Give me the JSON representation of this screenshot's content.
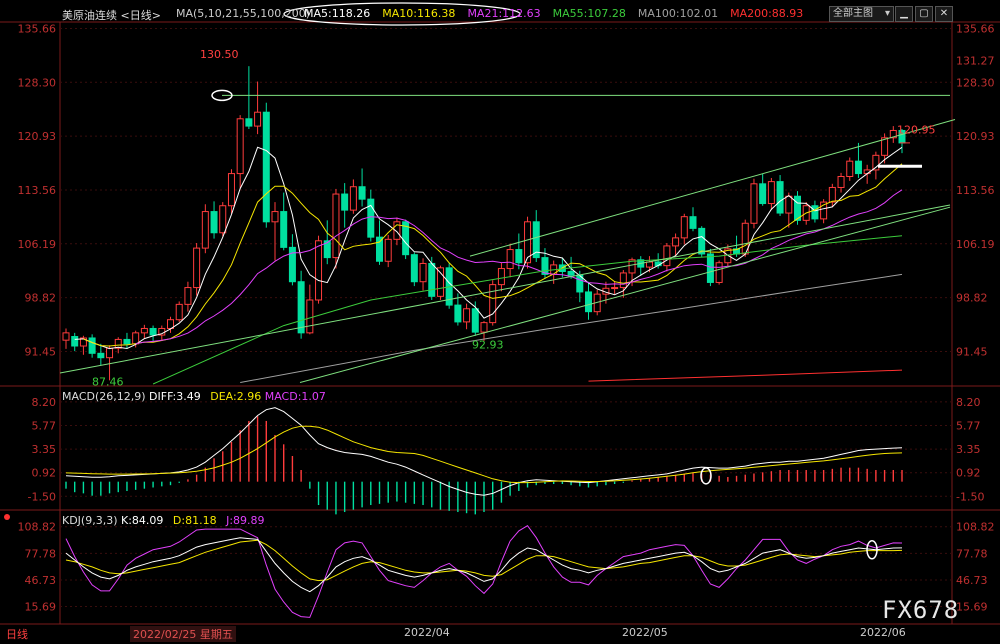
{
  "header": {
    "title": "美原油连续",
    "period": "<日线>",
    "ma_params": "MA(5,10,21,55,100,200)",
    "ma_values": [
      {
        "label": "MA5:118.26",
        "color": "#ffffff"
      },
      {
        "label": "MA10:116.38",
        "color": "#f5e600"
      },
      {
        "label": "MA21:112.63",
        "color": "#e040fb"
      },
      {
        "label": "MA55:107.28",
        "color": "#3ccc3c"
      },
      {
        "label": "MA100:102.01",
        "color": "#a0a0a0"
      },
      {
        "label": "MA200:88.93",
        "color": "#ff3030"
      }
    ],
    "dropdown_label": "全部主图",
    "dropdown_icon": "chevron-down-icon"
  },
  "window_buttons": {
    "minimize_icon": "minimize-icon",
    "restore_icon": "restore-icon",
    "close_icon": "close-icon"
  },
  "price_axis": {
    "ticks": [
      "135.66",
      "128.30",
      "120.93",
      "113.56",
      "106.19",
      "98.82",
      "91.45"
    ],
    "right_extra": "131.27"
  },
  "annotations": {
    "high": "130.50",
    "low1": "87.46",
    "low2": "92.93",
    "last": "120.95"
  },
  "macd": {
    "title": "MACD(26,12,9)",
    "diff": "DIFF:3.49",
    "dea": "DEA:2.96",
    "macd": "MACD:1.07",
    "ticks": [
      "8.20",
      "5.77",
      "3.35",
      "0.92",
      "-1.50"
    ]
  },
  "kdj": {
    "title": "KDJ(9,3,3)",
    "k": "K:84.09",
    "d": "D:81.18",
    "j": "J:89.89",
    "ticks": [
      "108.82",
      "77.78",
      "46.73",
      "15.69"
    ]
  },
  "footer": {
    "period_tab": "日线",
    "cursor_date": "2022/02/25 星期五",
    "dates": [
      "2022/04",
      "2022/05",
      "2022/06"
    ]
  },
  "watermark": "FX678",
  "chart_data": {
    "type": "candlestick",
    "price_range": [
      87.0,
      136.0
    ],
    "candles": [
      [
        93.0,
        94.6,
        91.8,
        94.0
      ],
      [
        93.5,
        94.0,
        91.5,
        92.2
      ],
      [
        92.2,
        93.6,
        91.0,
        93.3
      ],
      [
        93.3,
        93.8,
        90.6,
        91.2
      ],
      [
        91.2,
        92.5,
        89.6,
        90.6
      ],
      [
        90.6,
        92.3,
        87.5,
        91.9
      ],
      [
        91.9,
        93.4,
        91.2,
        93.1
      ],
      [
        93.1,
        94.0,
        91.9,
        92.5
      ],
      [
        92.5,
        94.3,
        92.0,
        94.0
      ],
      [
        94.0,
        95.1,
        93.3,
        94.6
      ],
      [
        94.6,
        95.0,
        92.8,
        93.7
      ],
      [
        93.7,
        95.0,
        93.0,
        94.6
      ],
      [
        94.6,
        96.2,
        94.0,
        95.8
      ],
      [
        95.8,
        98.3,
        95.5,
        97.9
      ],
      [
        97.9,
        101.0,
        96.9,
        100.2
      ],
      [
        100.2,
        106.3,
        99.1,
        105.6
      ],
      [
        105.6,
        111.6,
        104.9,
        110.6
      ],
      [
        110.6,
        112.0,
        106.9,
        107.7
      ],
      [
        107.7,
        111.9,
        107.2,
        111.4
      ],
      [
        111.4,
        116.4,
        110.3,
        115.8
      ],
      [
        115.8,
        123.8,
        113.8,
        123.3
      ],
      [
        123.3,
        130.5,
        121.9,
        122.3
      ],
      [
        122.3,
        128.4,
        121.2,
        124.2
      ],
      [
        124.2,
        125.5,
        108.4,
        109.2
      ],
      [
        109.2,
        111.9,
        103.9,
        110.6
      ],
      [
        110.6,
        113.2,
        105.3,
        105.7
      ],
      [
        105.7,
        107.5,
        100.5,
        101.0
      ],
      [
        101.0,
        102.5,
        93.2,
        94.0
      ],
      [
        94.0,
        100.6,
        93.8,
        98.5
      ],
      [
        98.5,
        107.3,
        98.0,
        106.6
      ],
      [
        106.6,
        109.4,
        103.4,
        104.3
      ],
      [
        104.3,
        113.7,
        102.8,
        113.0
      ],
      [
        113.0,
        114.5,
        108.4,
        110.8
      ],
      [
        110.8,
        115.0,
        110.3,
        114.0
      ],
      [
        114.0,
        116.5,
        111.3,
        112.3
      ],
      [
        112.3,
        113.6,
        106.5,
        107.1
      ],
      [
        107.1,
        109.4,
        103.3,
        103.8
      ],
      [
        103.8,
        107.4,
        103.0,
        106.8
      ],
      [
        106.8,
        109.8,
        106.0,
        109.2
      ],
      [
        109.2,
        109.5,
        104.1,
        104.7
      ],
      [
        104.7,
        105.0,
        100.4,
        101.0
      ],
      [
        101.0,
        104.2,
        99.8,
        103.5
      ],
      [
        103.5,
        104.4,
        98.5,
        99.0
      ],
      [
        99.0,
        103.2,
        98.5,
        102.9
      ],
      [
        102.9,
        103.5,
        97.3,
        97.8
      ],
      [
        97.8,
        99.4,
        95.0,
        95.5
      ],
      [
        95.5,
        98.0,
        94.5,
        97.3
      ],
      [
        97.3,
        98.3,
        93.6,
        94.1
      ],
      [
        94.1,
        95.6,
        92.9,
        95.4
      ],
      [
        95.4,
        101.2,
        95.0,
        100.6
      ],
      [
        100.6,
        103.6,
        99.7,
        102.8
      ],
      [
        102.8,
        106.2,
        101.6,
        105.4
      ],
      [
        105.4,
        107.6,
        102.7,
        103.6
      ],
      [
        103.6,
        109.9,
        102.8,
        109.2
      ],
      [
        109.2,
        110.8,
        103.7,
        104.3
      ],
      [
        104.3,
        105.6,
        101.4,
        102.0
      ],
      [
        102.0,
        103.9,
        100.7,
        103.3
      ],
      [
        103.3,
        104.3,
        101.6,
        102.4
      ],
      [
        102.4,
        104.4,
        101.4,
        101.9
      ],
      [
        101.9,
        102.5,
        98.2,
        99.6
      ],
      [
        99.6,
        101.0,
        95.8,
        96.9
      ],
      [
        96.9,
        99.9,
        96.4,
        99.3
      ],
      [
        99.3,
        101.0,
        98.0,
        100.1
      ],
      [
        100.1,
        101.1,
        99.3,
        100.2
      ],
      [
        100.2,
        102.6,
        98.8,
        102.2
      ],
      [
        102.2,
        104.3,
        100.4,
        104.0
      ],
      [
        104.0,
        104.5,
        101.8,
        103.0
      ],
      [
        103.0,
        104.5,
        102.3,
        103.7
      ],
      [
        103.7,
        104.9,
        102.8,
        103.2
      ],
      [
        103.2,
        106.3,
        102.4,
        105.9
      ],
      [
        105.9,
        107.6,
        104.4,
        107.0
      ],
      [
        107.0,
        110.3,
        106.1,
        109.9
      ],
      [
        109.9,
        111.2,
        107.9,
        108.3
      ],
      [
        108.3,
        108.6,
        104.4,
        104.8
      ],
      [
        104.8,
        105.5,
        100.4,
        100.9
      ],
      [
        100.9,
        103.9,
        100.6,
        103.6
      ],
      [
        103.6,
        106.1,
        103.1,
        105.5
      ],
      [
        105.5,
        107.3,
        104.4,
        104.8
      ],
      [
        104.8,
        109.5,
        104.4,
        109.0
      ],
      [
        109.0,
        115.1,
        108.3,
        114.4
      ],
      [
        114.4,
        115.8,
        111.4,
        111.7
      ],
      [
        111.7,
        115.2,
        110.8,
        114.7
      ],
      [
        114.7,
        115.6,
        110.0,
        110.4
      ],
      [
        110.4,
        113.2,
        108.4,
        112.7
      ],
      [
        112.7,
        113.4,
        108.8,
        109.4
      ],
      [
        109.4,
        111.9,
        108.8,
        111.4
      ],
      [
        111.4,
        112.1,
        109.1,
        109.6
      ],
      [
        109.6,
        112.3,
        109.0,
        111.9
      ],
      [
        111.9,
        114.4,
        111.2,
        113.9
      ],
      [
        113.9,
        115.9,
        113.2,
        115.4
      ],
      [
        115.4,
        118.0,
        114.8,
        117.5
      ],
      [
        117.5,
        120.0,
        115.2,
        115.8
      ],
      [
        115.8,
        117.0,
        114.4,
        116.3
      ],
      [
        116.3,
        118.8,
        115.0,
        118.3
      ],
      [
        118.3,
        121.3,
        117.2,
        120.7
      ],
      [
        120.7,
        122.3,
        120.0,
        121.7
      ],
      [
        121.7,
        121.9,
        118.6,
        120.0
      ]
    ],
    "macd_hist": [
      -0.3,
      -0.45,
      -0.5,
      -0.6,
      -0.6,
      -0.5,
      -0.45,
      -0.4,
      -0.35,
      -0.3,
      -0.25,
      -0.2,
      -0.15,
      -0.05,
      0.1,
      0.3,
      0.6,
      1.0,
      1.3,
      1.7,
      2.2,
      2.6,
      2.8,
      2.6,
      2.0,
      1.6,
      1.1,
      0.5,
      -0.3,
      -1.0,
      -1.2,
      -1.4,
      -1.3,
      -1.2,
      -1.1,
      -1.0,
      -0.95,
      -0.9,
      -0.85,
      -0.9,
      -0.95,
      -1.0,
      -1.1,
      -1.2,
      -1.25,
      -1.3,
      -1.35,
      -1.4,
      -1.3,
      -1.2,
      -0.9,
      -0.6,
      -0.4,
      -0.25,
      -0.15,
      -0.1,
      -0.1,
      -0.1,
      -0.15,
      -0.2,
      -0.25,
      -0.2,
      -0.15,
      -0.1,
      -0.05,
      0.05,
      0.1,
      0.15,
      0.2,
      0.25,
      0.3,
      0.35,
      0.4,
      0.35,
      0.3,
      0.25,
      0.2,
      0.25,
      0.3,
      0.35,
      0.4,
      0.45,
      0.5,
      0.5,
      0.5,
      0.5,
      0.5,
      0.5,
      0.55,
      0.6,
      0.6,
      0.6,
      0.55,
      0.5,
      0.5,
      0.5,
      0.5
    ],
    "macd_diff": [
      0.6,
      0.55,
      0.5,
      0.45,
      0.45,
      0.5,
      0.6,
      0.65,
      0.7,
      0.75,
      0.8,
      0.85,
      0.9,
      1.0,
      1.2,
      1.5,
      2.0,
      2.7,
      3.4,
      4.2,
      5.0,
      5.9,
      6.8,
      7.4,
      7.6,
      7.2,
      6.5,
      5.8,
      4.8,
      3.9,
      3.5,
      3.2,
      3.0,
      2.9,
      2.8,
      2.6,
      2.3,
      2.0,
      1.8,
      1.5,
      1.1,
      0.7,
      0.3,
      -0.1,
      -0.5,
      -0.8,
      -1.1,
      -1.3,
      -1.4,
      -1.2,
      -0.8,
      -0.4,
      -0.1,
      0.1,
      0.2,
      0.15,
      0.1,
      0.05,
      0.0,
      -0.05,
      -0.1,
      0.0,
      0.1,
      0.2,
      0.3,
      0.4,
      0.5,
      0.6,
      0.7,
      0.8,
      1.0,
      1.2,
      1.4,
      1.5,
      1.45,
      1.4,
      1.4,
      1.5,
      1.6,
      1.8,
      1.9,
      2.0,
      2.0,
      2.1,
      2.1,
      2.2,
      2.3,
      2.4,
      2.6,
      2.8,
      3.0,
      3.2,
      3.3,
      3.35,
      3.4,
      3.45,
      3.49
    ],
    "macd_dea": [
      0.9,
      0.88,
      0.85,
      0.82,
      0.8,
      0.78,
      0.78,
      0.78,
      0.79,
      0.8,
      0.82,
      0.85,
      0.88,
      0.92,
      0.98,
      1.08,
      1.22,
      1.42,
      1.7,
      2.0,
      2.4,
      2.9,
      3.4,
      4.0,
      4.6,
      5.1,
      5.5,
      5.7,
      5.7,
      5.6,
      5.3,
      4.9,
      4.5,
      4.1,
      3.8,
      3.5,
      3.3,
      3.1,
      3.0,
      2.95,
      2.9,
      2.7,
      2.4,
      2.1,
      1.8,
      1.5,
      1.2,
      0.9,
      0.6,
      0.3,
      0.1,
      -0.05,
      -0.1,
      -0.1,
      -0.05,
      0.0,
      0.05,
      0.08,
      0.07,
      0.05,
      0.02,
      0.02,
      0.04,
      0.08,
      0.14,
      0.2,
      0.28,
      0.36,
      0.45,
      0.55,
      0.66,
      0.78,
      0.92,
      1.04,
      1.13,
      1.2,
      1.26,
      1.32,
      1.4,
      1.48,
      1.56,
      1.65,
      1.74,
      1.82,
      1.9,
      1.98,
      2.06,
      2.14,
      2.24,
      2.35,
      2.47,
      2.6,
      2.72,
      2.82,
      2.9,
      2.94,
      2.96
    ],
    "kdj_k": [
      78,
      70,
      62,
      55,
      50,
      48,
      52,
      58,
      62,
      65,
      68,
      70,
      72,
      75,
      80,
      85,
      88,
      90,
      92,
      94,
      96,
      95,
      94,
      80,
      66,
      55,
      45,
      38,
      33,
      40,
      50,
      62,
      68,
      72,
      74,
      70,
      64,
      58,
      55,
      52,
      50,
      52,
      55,
      58,
      60,
      58,
      55,
      50,
      45,
      48,
      58,
      70,
      78,
      84,
      82,
      76,
      70,
      64,
      60,
      58,
      55,
      58,
      60,
      63,
      66,
      68,
      70,
      72,
      74,
      76,
      78,
      79,
      75,
      68,
      60,
      56,
      58,
      62,
      66,
      72,
      78,
      80,
      82,
      78,
      74,
      72,
      73,
      75,
      78,
      80,
      82,
      84,
      83,
      82,
      83,
      84,
      84.09
    ],
    "kdj_d": [
      70,
      68,
      65,
      62,
      58,
      55,
      54,
      55,
      57,
      59,
      61,
      63,
      65,
      67,
      71,
      75,
      79,
      82,
      85,
      88,
      91,
      92,
      93,
      88,
      81,
      72,
      63,
      55,
      48,
      46,
      47,
      52,
      57,
      62,
      66,
      68,
      67,
      64,
      61,
      58,
      56,
      55,
      55,
      56,
      57,
      58,
      57,
      55,
      52,
      51,
      53,
      59,
      65,
      71,
      75,
      75,
      74,
      71,
      68,
      65,
      62,
      61,
      60,
      61,
      62,
      64,
      66,
      67,
      69,
      71,
      73,
      75,
      75,
      73,
      69,
      65,
      63,
      63,
      64,
      67,
      70,
      73,
      76,
      77,
      76,
      75,
      74,
      75,
      76,
      77,
      79,
      80,
      81,
      81,
      81,
      81,
      81.18
    ],
    "kdj_j": [
      95,
      74,
      56,
      41,
      34,
      34,
      48,
      64,
      72,
      77,
      82,
      84,
      86,
      91,
      98,
      105,
      106,
      106,
      106,
      106,
      106,
      101,
      96,
      64,
      36,
      21,
      9,
      4,
      3,
      28,
      56,
      82,
      90,
      92,
      90,
      74,
      58,
      46,
      43,
      40,
      38,
      46,
      55,
      62,
      66,
      58,
      51,
      40,
      31,
      42,
      68,
      92,
      104,
      110,
      96,
      78,
      62,
      50,
      44,
      44,
      41,
      52,
      60,
      67,
      74,
      76,
      78,
      82,
      84,
      86,
      88,
      87,
      75,
      58,
      42,
      38,
      48,
      60,
      70,
      82,
      94,
      94,
      94,
      80,
      70,
      66,
      71,
      75,
      82,
      86,
      88,
      92,
      87,
      84,
      87,
      90,
      89.89
    ]
  }
}
